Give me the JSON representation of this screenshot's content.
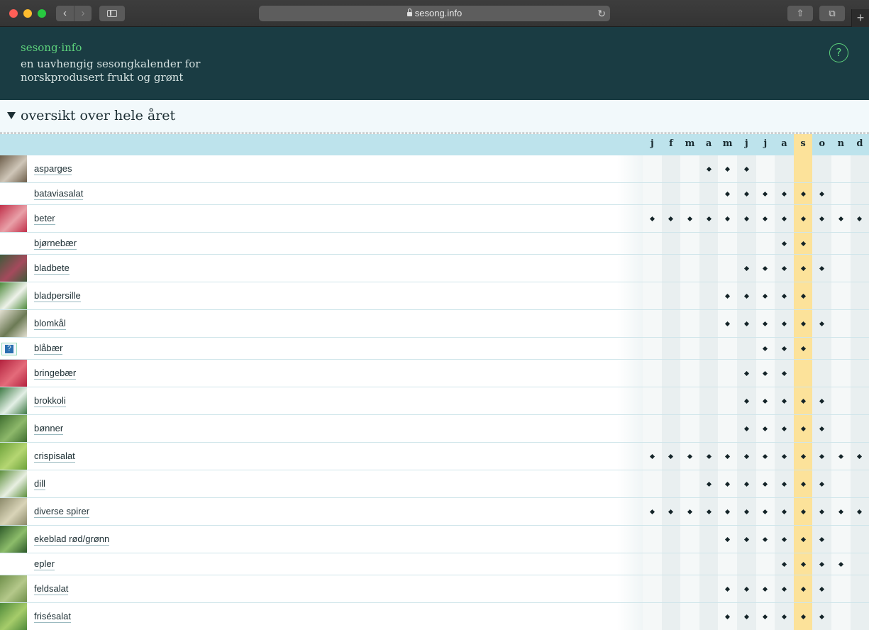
{
  "browser": {
    "url": "sesong.info",
    "icons": [
      "back-icon",
      "forward-icon",
      "sidebar-icon",
      "lock-icon",
      "reload-icon",
      "share-icon",
      "tabs-icon",
      "plus-icon"
    ]
  },
  "site": {
    "logo": "sesong·info",
    "tagline": "en uavhengig sesongkalender for norskprodusert frukt og grønt",
    "help_label": "?"
  },
  "section": {
    "title": "oversikt over hele året"
  },
  "calendar": {
    "months": [
      "j",
      "f",
      "m",
      "a",
      "m",
      "j",
      "j",
      "a",
      "s",
      "o",
      "n",
      "d"
    ],
    "current_month_index": 8,
    "colors": {
      "header": "#1a3c43",
      "accent": "#5dd27c",
      "month_bar": "#bde3ec",
      "current_month": "#fce29a"
    },
    "items": [
      {
        "name": "asparges",
        "thumb": "#6d5e4a",
        "thumb2": "#cfc6b8",
        "season": [
          3,
          4,
          5
        ]
      },
      {
        "name": "bataviasalat",
        "thumb": "",
        "season": [
          4,
          5,
          6,
          7,
          8,
          9
        ]
      },
      {
        "name": "beter",
        "thumb": "#c0304a",
        "thumb2": "#e9a0a8",
        "season": [
          0,
          1,
          2,
          3,
          4,
          5,
          6,
          7,
          8,
          9,
          10,
          11
        ]
      },
      {
        "name": "bjørnebær",
        "thumb": "",
        "season": [
          7,
          8
        ]
      },
      {
        "name": "bladbete",
        "thumb": "#3f5a3a",
        "thumb2": "#a44a5c",
        "season": [
          5,
          6,
          7,
          8,
          9
        ]
      },
      {
        "name": "bladpersille",
        "thumb": "#4e8a3c",
        "thumb2": "#eef2ea",
        "season": [
          4,
          5,
          6,
          7,
          8
        ]
      },
      {
        "name": "blomkål",
        "thumb": "#e3e0d2",
        "thumb2": "#6c7a55",
        "season": [
          4,
          5,
          6,
          7,
          8,
          9
        ]
      },
      {
        "name": "blåbær",
        "thumb": "broken",
        "season": [
          6,
          7,
          8
        ]
      },
      {
        "name": "bringebær",
        "thumb": "#b3223e",
        "thumb2": "#e46b7a",
        "season": [
          5,
          6,
          7
        ]
      },
      {
        "name": "brokkoli",
        "thumb": "#3e7a45",
        "thumb2": "#e3efe6",
        "season": [
          5,
          6,
          7,
          8,
          9
        ]
      },
      {
        "name": "bønner",
        "thumb": "#3f6e30",
        "thumb2": "#8db86a",
        "season": [
          5,
          6,
          7,
          8,
          9
        ]
      },
      {
        "name": "crispisalat",
        "thumb": "#6da23a",
        "thumb2": "#b5d672",
        "season": [
          0,
          1,
          2,
          3,
          4,
          5,
          6,
          7,
          8,
          9,
          10,
          11
        ]
      },
      {
        "name": "dill",
        "thumb": "#5d8f3c",
        "thumb2": "#e8efe2",
        "season": [
          3,
          4,
          5,
          6,
          7,
          8,
          9
        ]
      },
      {
        "name": "diverse spirer",
        "thumb": "#8c8a6a",
        "thumb2": "#d9d4b8",
        "season": [
          0,
          1,
          2,
          3,
          4,
          5,
          6,
          7,
          8,
          9,
          10,
          11
        ]
      },
      {
        "name": "ekeblad rød/grønn",
        "thumb": "#2e5a2a",
        "thumb2": "#8cbc6a",
        "season": [
          4,
          5,
          6,
          7,
          8,
          9
        ]
      },
      {
        "name": "epler",
        "thumb": "",
        "season": [
          7,
          8,
          9,
          10
        ]
      },
      {
        "name": "feldsalat",
        "thumb": "#6f8f4a",
        "thumb2": "#b4c88a",
        "season": [
          4,
          5,
          6,
          7,
          8,
          9
        ]
      },
      {
        "name": "frisésalat",
        "thumb": "#4f8a3a",
        "thumb2": "#a6cc6a",
        "season": [
          4,
          5,
          6,
          7,
          8,
          9
        ]
      }
    ]
  }
}
